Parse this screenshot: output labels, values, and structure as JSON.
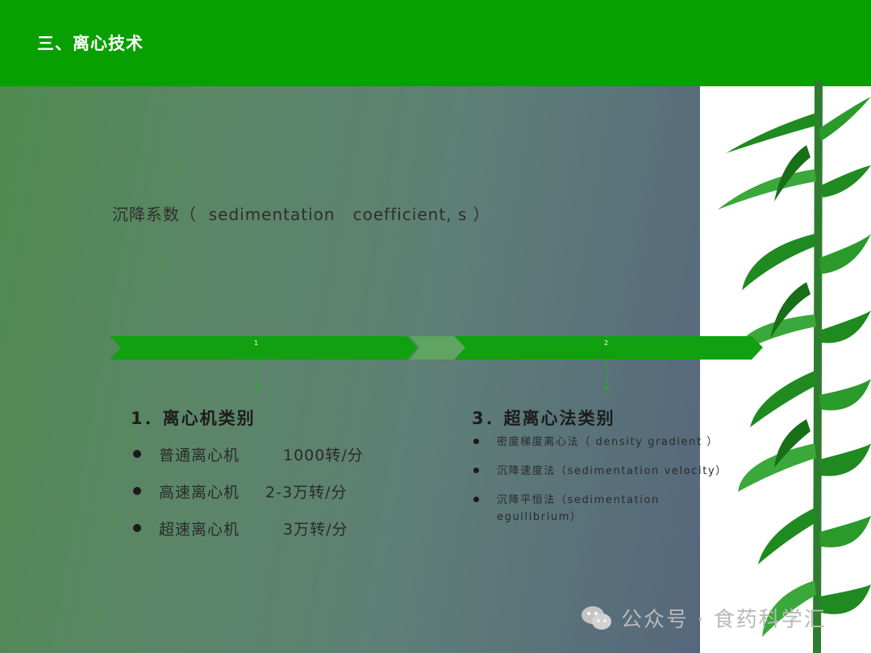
{
  "header": {
    "title": "三、离心技术"
  },
  "subtitle": "沉降系数（  sedimentation   coefficient, s ）",
  "timeline": {
    "step1": "1",
    "step2": "2"
  },
  "section1": {
    "title": "1．离心机类别",
    "items": [
      {
        "name": "普通离心机",
        "speed": "1000转/分"
      },
      {
        "name": "高速离心机",
        "speed": "2-3万转/分"
      },
      {
        "name": "超速离心机",
        "speed": "3万转/分"
      }
    ]
  },
  "section2": {
    "title": "3．超离心法类别",
    "items": [
      "密度梯度离心法（  density gradient  ）",
      "沉降速度法（sedimentation velocity）",
      "沉降平恒法（sedimentation eguilibrium）"
    ]
  },
  "watermark": {
    "text": "公众号 · 食药科学汇",
    "icon": "wechat-icon"
  },
  "colors": {
    "header": "#08a000",
    "arrow": "#10a010",
    "arrow_faded": "#5fa460",
    "connector": "#1fb01f"
  }
}
